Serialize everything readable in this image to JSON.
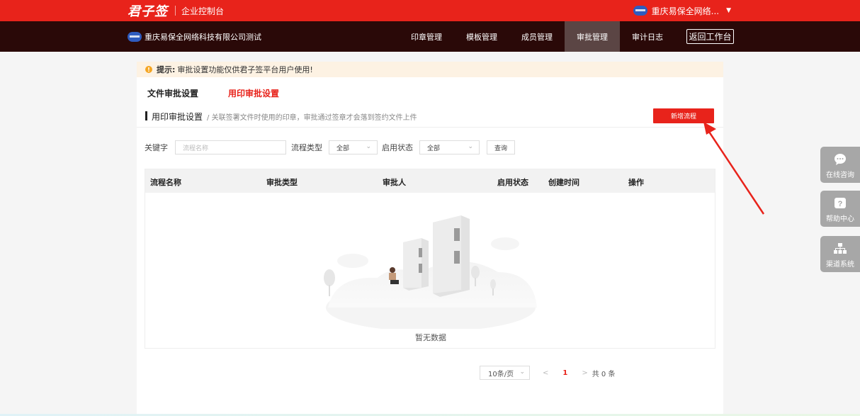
{
  "topbar": {
    "logo": "君子签",
    "console_title": "企业控制台",
    "user_name": "重庆易保全网络...",
    "caret": "▼"
  },
  "navbar": {
    "company": "重庆易保全网络科技有限公司测试",
    "items": [
      {
        "label": "印章管理"
      },
      {
        "label": "模板管理"
      },
      {
        "label": "成员管理"
      },
      {
        "label": "审批管理",
        "active": true
      },
      {
        "label": "审计日志"
      }
    ],
    "back_label": "返回工作台"
  },
  "notice": {
    "icon": "!",
    "strong": "提示:",
    "text": "审批设置功能仅供君子签平台用户使用!"
  },
  "tabs": [
    {
      "label": "文件审批设置"
    },
    {
      "label": "用印审批设置",
      "active": true
    }
  ],
  "section": {
    "title": "用印审批设置",
    "desc": "/ 关联签署文件时使用的印章，审批通过签章才会落到签约文件上件",
    "new_button": "新增流程"
  },
  "filters": {
    "keyword_label": "关键字",
    "keyword_placeholder": "流程名称",
    "type_label": "流程类型",
    "type_value": "全部",
    "status_label": "启用状态",
    "status_value": "全部",
    "query_label": "查询"
  },
  "table": {
    "columns": [
      "流程名称",
      "审批类型",
      "审批人",
      "启用状态",
      "创建时间",
      "操作"
    ],
    "empty_text": "暂无数据"
  },
  "pagination": {
    "page_size": "10条/页",
    "prev": "<",
    "current": "1",
    "next": ">",
    "total": "共 0 条"
  },
  "side_widgets": [
    {
      "label": "在线咨询",
      "icon": "chat-bubble-icon"
    },
    {
      "label": "帮助中心",
      "icon": "question-icon"
    },
    {
      "label": "渠道系统",
      "icon": "org-chart-icon"
    }
  ],
  "colors": {
    "brand_red": "#e8231b",
    "nav_dark": "#2a0908",
    "nav_active": "#5b4544",
    "side_gray": "#a7a7a7"
  }
}
